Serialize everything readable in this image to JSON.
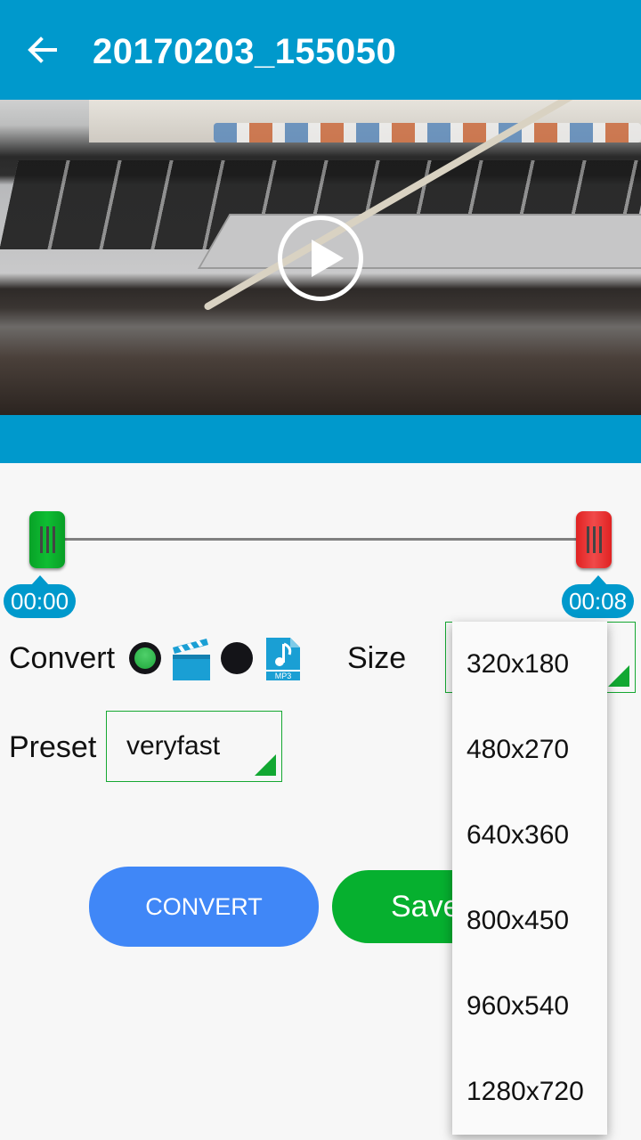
{
  "appbar": {
    "title": "20170203_155050",
    "back_icon": "arrow-left-icon"
  },
  "video": {
    "play_icon": "play-circle-icon"
  },
  "range": {
    "start_time": "00:00",
    "end_time": "00:08"
  },
  "convert": {
    "label": "Convert",
    "options": [
      {
        "name": "video",
        "icon": "clapperboard-icon",
        "selected": true
      },
      {
        "name": "mp3",
        "icon": "mp3-file-icon",
        "selected": false,
        "badge": "MP3"
      }
    ]
  },
  "size": {
    "label": "Size",
    "selected": "320x180",
    "options": [
      "320x180",
      "480x270",
      "640x360",
      "800x450",
      "960x540",
      "1280x720"
    ]
  },
  "preset": {
    "label": "Preset",
    "selected": "veryfast"
  },
  "buttons": {
    "convert": "CONVERT",
    "save": "Save"
  },
  "colors": {
    "primary": "#0099cc",
    "accent_green": "#06b02f",
    "convert_blue": "#4087f7",
    "end_red": "#f04a4a"
  }
}
